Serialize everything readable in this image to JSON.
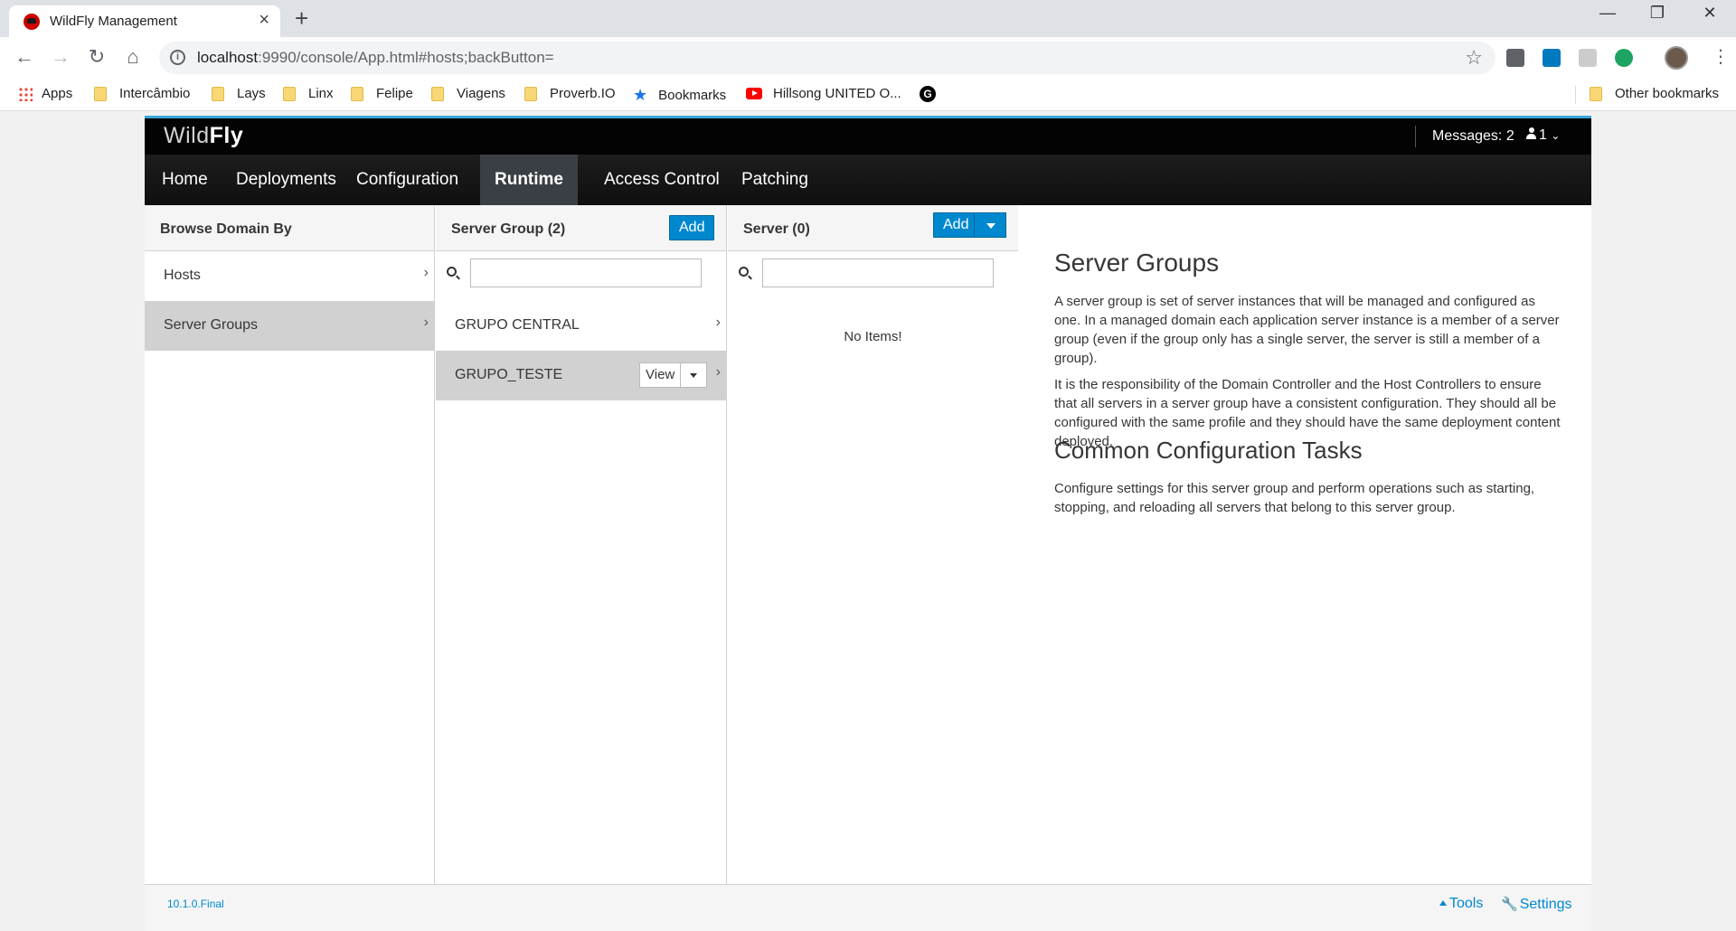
{
  "browser": {
    "tab_title": "WildFly Management",
    "url_host": "localhost",
    "url_path": ":9990/console/App.html#hosts;backButton=",
    "bookmarks": [
      {
        "label": "Apps",
        "icon": "apps-icon"
      },
      {
        "label": "Intercâmbio",
        "icon": "folder-icon"
      },
      {
        "label": "Lays",
        "icon": "folder-icon"
      },
      {
        "label": "Linx",
        "icon": "folder-icon"
      },
      {
        "label": "Felipe",
        "icon": "folder-icon"
      },
      {
        "label": "Viagens",
        "icon": "folder-icon"
      },
      {
        "label": "Proverb.IO",
        "icon": "folder-icon"
      },
      {
        "label": "Bookmarks",
        "icon": "star-icon"
      },
      {
        "label": "Hillsong UNITED O...",
        "icon": "youtube-icon"
      },
      {
        "label": "",
        "icon": "g-icon"
      }
    ],
    "other_bookmarks": "Other bookmarks"
  },
  "app": {
    "brand_light": "Wild",
    "brand_bold": "Fly",
    "messages": "Messages: 2",
    "user_count": "1",
    "nav": [
      "Home",
      "Deployments",
      "Configuration",
      "Runtime",
      "Access Control",
      "Patching"
    ],
    "nav_active": "Runtime",
    "browse": {
      "title": "Browse Domain By",
      "items": [
        "Hosts",
        "Server Groups"
      ],
      "selected": "Server Groups"
    },
    "server_groups": {
      "title": "Server Group (2)",
      "add_label": "Add",
      "items": [
        "GRUPO CENTRAL",
        "GRUPO_TESTE"
      ],
      "selected": "GRUPO_TESTE",
      "view_label": "View"
    },
    "servers": {
      "title": "Server (0)",
      "add_label": "Add",
      "empty": "No Items!"
    },
    "preview": {
      "heading1": "Server Groups",
      "para1": "A server group is set of server instances that will be managed and configured as one. In a managed domain each application server instance is a member of a server group (even if the group only has a single server, the server is still a member of a group).",
      "para2": "It is the responsibility of the Domain Controller and the Host Controllers to ensure that all servers in a server group have a consistent configuration. They should all be configured with the same profile and they should have the same deployment content deployed.",
      "heading2": "Common Configuration Tasks",
      "para3": "Configure settings for this server group and perform operations such as starting, stopping, and reloading all servers that belong to this server group."
    },
    "footer": {
      "version": "10.1.0.Final",
      "tools": "Tools",
      "settings": "Settings"
    }
  },
  "colors": {
    "primary": "#0088ce",
    "masthead": "#030303",
    "nav_active": "#393f44",
    "selected_row": "#d1d1d1"
  }
}
